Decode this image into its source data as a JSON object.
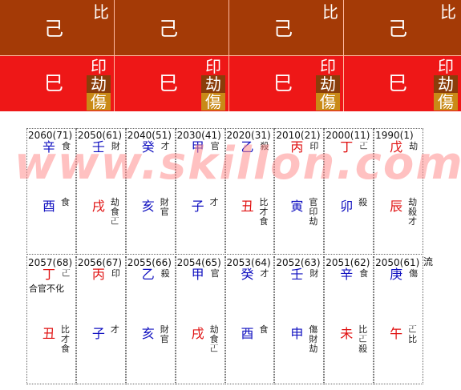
{
  "pillars": [
    {
      "stem": "己",
      "stem_god": "比",
      "branch": "巳",
      "branch_gods": [
        "印",
        "劫",
        "傷"
      ]
    },
    {
      "stem": "己",
      "stem_god": "",
      "branch": "巳",
      "branch_gods": [
        "印",
        "劫",
        "傷"
      ]
    },
    {
      "stem": "己",
      "stem_god": "比",
      "branch": "巳",
      "branch_gods": [
        "印",
        "劫",
        "傷"
      ]
    },
    {
      "stem": "己",
      "stem_god": "比",
      "branch": "巳",
      "branch_gods": [
        "印",
        "劫",
        "傷"
      ]
    }
  ],
  "luck_row1": [
    {
      "header": "2060(71)",
      "stem": "辛",
      "stem_color": "blue",
      "stem_god": "食",
      "note": "",
      "branch": "酉",
      "branch_color": "blue",
      "hidden": [
        "食"
      ]
    },
    {
      "header": "2050(61)",
      "stem": "壬",
      "stem_color": "blue",
      "stem_god": "財",
      "note": "",
      "branch": "戌",
      "branch_color": "red",
      "hidden": [
        "劫",
        "食",
        "𠀀"
      ]
    },
    {
      "header": "2040(51)",
      "stem": "癸",
      "stem_color": "blue",
      "stem_god": "才",
      "note": "",
      "branch": "亥",
      "branch_color": "blue",
      "hidden": [
        "財",
        "官"
      ]
    },
    {
      "header": "2030(41)",
      "stem": "甲",
      "stem_color": "blue",
      "stem_god": "官",
      "note": "",
      "branch": "子",
      "branch_color": "blue",
      "hidden": [
        "才"
      ]
    },
    {
      "header": "2020(31)",
      "stem": "乙",
      "stem_color": "blue",
      "stem_god": "殺",
      "note": "",
      "branch": "丑",
      "branch_color": "red",
      "hidden": [
        "比",
        "才",
        "食"
      ]
    },
    {
      "header": "2010(21)",
      "stem": "丙",
      "stem_color": "red",
      "stem_god": "印",
      "note": "",
      "branch": "寅",
      "branch_color": "blue",
      "hidden": [
        "官",
        "印",
        "劫"
      ]
    },
    {
      "header": "2000(11)",
      "stem": "丁",
      "stem_color": "red",
      "stem_god": "𠀀",
      "note": "",
      "branch": "卯",
      "branch_color": "blue",
      "hidden": [
        "殺"
      ]
    },
    {
      "header": "1990(1)",
      "stem": "戊",
      "stem_color": "red",
      "stem_god": "劫",
      "note": "",
      "branch": "辰",
      "branch_color": "red",
      "hidden": [
        "劫",
        "殺",
        "才"
      ]
    }
  ],
  "luck_row2": [
    {
      "header": "2057(68)",
      "stem": "丁",
      "stem_color": "red",
      "stem_god": "𠀀",
      "note": "合官不化",
      "branch": "丑",
      "branch_color": "red",
      "hidden": [
        "比",
        "才",
        "食"
      ]
    },
    {
      "header": "2056(67)",
      "stem": "丙",
      "stem_color": "red",
      "stem_god": "印",
      "note": "",
      "branch": "子",
      "branch_color": "blue",
      "hidden": [
        "才"
      ]
    },
    {
      "header": "2055(66)",
      "stem": "乙",
      "stem_color": "blue",
      "stem_god": "殺",
      "note": "",
      "branch": "亥",
      "branch_color": "blue",
      "hidden": [
        "財",
        "官"
      ]
    },
    {
      "header": "2054(65)",
      "stem": "甲",
      "stem_color": "blue",
      "stem_god": "官",
      "note": "",
      "branch": "戌",
      "branch_color": "red",
      "hidden": [
        "劫",
        "食",
        "𠀀"
      ]
    },
    {
      "header": "2053(64)",
      "stem": "癸",
      "stem_color": "blue",
      "stem_god": "才",
      "note": "",
      "branch": "酉",
      "branch_color": "blue",
      "hidden": [
        "食"
      ]
    },
    {
      "header": "2052(63)",
      "stem": "壬",
      "stem_color": "blue",
      "stem_god": "財",
      "note": "",
      "branch": "申",
      "branch_color": "blue",
      "hidden": [
        "傷",
        "財",
        "劫"
      ]
    },
    {
      "header": "2051(62)",
      "stem": "辛",
      "stem_color": "blue",
      "stem_god": "食",
      "note": "",
      "branch": "未",
      "branch_color": "red",
      "hidden": [
        "比",
        "𠀀",
        "殺"
      ]
    },
    {
      "header": "2050(61)",
      "stem": "庚",
      "stem_color": "blue",
      "stem_god": "傷",
      "note": "",
      "branch": "午",
      "branch_color": "red",
      "hidden": [
        "𠀀",
        "比"
      ]
    }
  ],
  "side_glyph": "流",
  "watermark": "www.skillon.com"
}
